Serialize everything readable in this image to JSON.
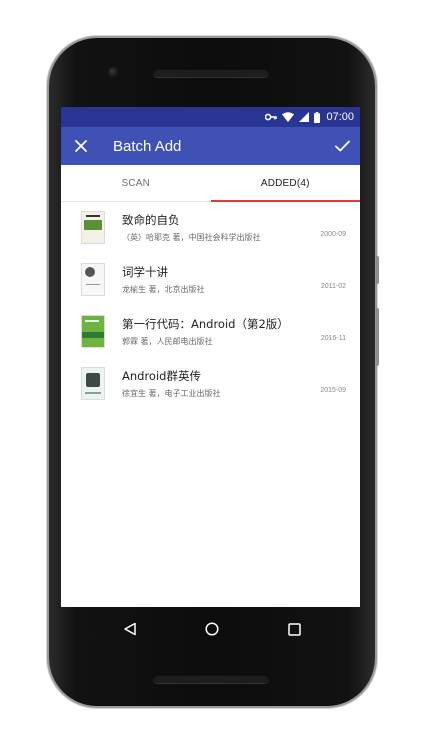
{
  "status_bar": {
    "time": "07:00",
    "icons": [
      "vpn-key-icon",
      "wifi-icon",
      "signal-icon",
      "battery-icon"
    ]
  },
  "app_bar": {
    "title": "Batch Add",
    "close_icon": "close-icon",
    "done_icon": "check-icon"
  },
  "tabs": [
    {
      "label": "SCAN",
      "active": false
    },
    {
      "label": "ADDED(4)",
      "active": true
    }
  ],
  "books": [
    {
      "title": "致命的自负",
      "meta": "（英）哈耶克 著，中国社会科学出版社",
      "date": "2000-09"
    },
    {
      "title": "词学十讲",
      "meta": "龙榆生 著，北京出版社",
      "date": "2011-02"
    },
    {
      "title": "第一行代码：Android（第2版）",
      "meta": "郭霖 著，人民邮电出版社",
      "date": "2016-11"
    },
    {
      "title": "Android群英传",
      "meta": "徐宜生 著，电子工业出版社",
      "date": "2015-09"
    }
  ],
  "colors": {
    "status_bar": "#283593",
    "app_bar": "#3f51b5",
    "tab_indicator": "#e53935"
  },
  "nav_bar": {
    "icons": [
      "back-icon",
      "home-icon",
      "recents-icon"
    ]
  }
}
